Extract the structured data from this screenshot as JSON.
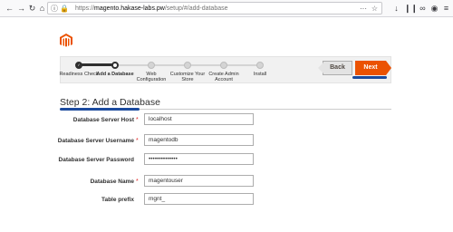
{
  "browser": {
    "url_scheme": "https://",
    "url_host": "magento.hakase-labs.pw",
    "url_path": "/setup/#/add-database",
    "more_label": "···"
  },
  "installer": {
    "back_label": "Back",
    "next_label": "Next",
    "steps": [
      {
        "label": "Readiness Check",
        "state": "done"
      },
      {
        "label": "Add a Database",
        "state": "active"
      },
      {
        "label": "Web Configuration",
        "state": "pending"
      },
      {
        "label": "Customize Your Store",
        "state": "pending"
      },
      {
        "label": "Create Admin Account",
        "state": "pending"
      },
      {
        "label": "Install",
        "state": "pending"
      }
    ]
  },
  "page": {
    "title": "Step 2: Add a Database"
  },
  "form": {
    "host_label": "Database Server Host",
    "host_value": "localhost",
    "username_label": "Database Server Username",
    "username_value": "magentodb",
    "password_label": "Database Server Password",
    "password_value": "••••••••••••••",
    "dbname_label": "Database Name",
    "dbname_value": "magentouser",
    "prefix_label": "Table prefix",
    "prefix_value": "mgnt_",
    "required_mark": "*"
  },
  "colors": {
    "accent": "#eb5202",
    "annotation": "#1c4b9e"
  }
}
